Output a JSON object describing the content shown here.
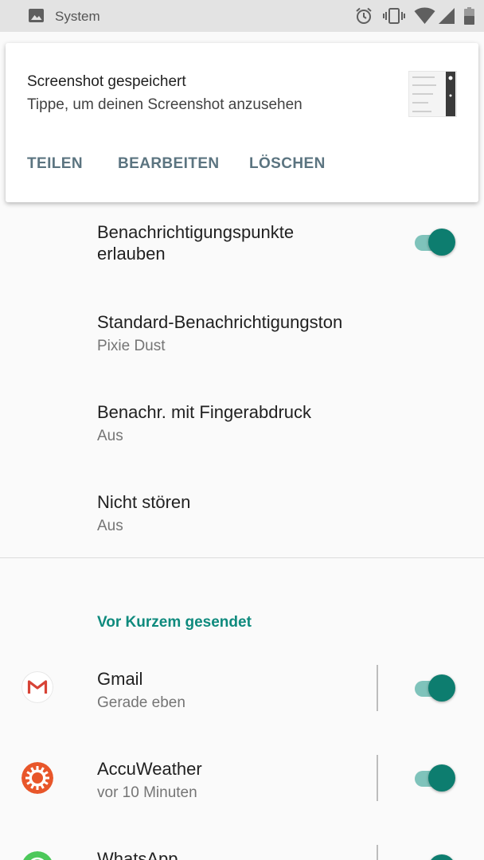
{
  "status_bar": {
    "app_name": "System",
    "icons": [
      "image-icon",
      "alarm-icon",
      "vibrate-icon",
      "wifi-icon",
      "signal-icon",
      "battery-icon"
    ]
  },
  "notification": {
    "title": "Screenshot gespeichert",
    "text": "Tippe, um deinen Screenshot anzusehen",
    "actions": [
      "TEILEN",
      "BEARBEITEN",
      "LÖSCHEN"
    ]
  },
  "settings": {
    "dots": {
      "title_line1": "Benachrichtigungspunkte",
      "title_line2": "erlauben",
      "enabled": true
    },
    "sound": {
      "title": "Standard-Benachrichtigungston",
      "subtitle": "Pixie Dust"
    },
    "fingerprint": {
      "title": "Benachr. mit Fingerabdruck",
      "subtitle": "Aus"
    },
    "dnd": {
      "title": "Nicht stören",
      "subtitle": "Aus"
    }
  },
  "recent": {
    "header": "Vor Kurzem gesendet",
    "apps": [
      {
        "name": "Gmail",
        "time": "Gerade eben",
        "icon": "gmail-icon",
        "enabled": true
      },
      {
        "name": "AccuWeather",
        "time": "vor 10 Minuten",
        "icon": "accuweather-icon",
        "enabled": true
      },
      {
        "name": "WhatsApp",
        "icon": "whatsapp-icon",
        "enabled": true
      }
    ]
  },
  "colors": {
    "accent": "#0e8a7d",
    "toggle_track": "#7fc3bb",
    "toggle_thumb": "#0d7d6f",
    "action_text": "#5b7480"
  }
}
